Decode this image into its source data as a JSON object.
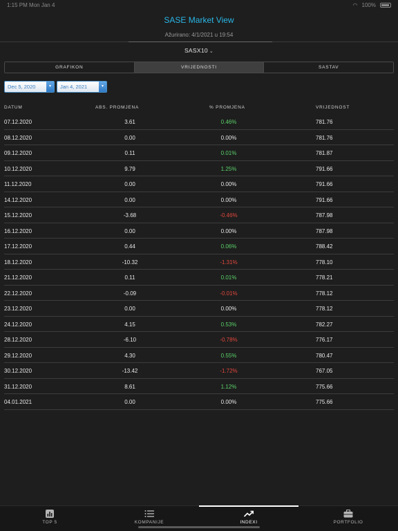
{
  "status": {
    "time": "1:15 PM",
    "date": "Mon Jan 4",
    "battery": "100%"
  },
  "header": {
    "title": "SASE Market View",
    "updated": "Ažurirano: 4/1/2021 u 19:54",
    "index_name": "SASX10"
  },
  "tabs": {
    "grafikon": "GRAFIKON",
    "vrijednosti": "VRIJEDNOSTI",
    "sastav": "SASTAV"
  },
  "dates": {
    "from": "Dec 5, 2020",
    "to": "Jan 4, 2021"
  },
  "table": {
    "headers": {
      "datum": "DATUM",
      "abs": "ABS. PROMJENA",
      "pct": "% PROMJENA",
      "value": "VRIJEDNOST"
    },
    "rows": [
      {
        "date": "07.12.2020",
        "abs": "3.61",
        "pct": "0.46%",
        "value": "781.76",
        "dir": "pos"
      },
      {
        "date": "08.12.2020",
        "abs": "0.00",
        "pct": "0.00%",
        "value": "781.76",
        "dir": "zero"
      },
      {
        "date": "09.12.2020",
        "abs": "0.11",
        "pct": "0.01%",
        "value": "781.87",
        "dir": "pos"
      },
      {
        "date": "10.12.2020",
        "abs": "9.79",
        "pct": "1.25%",
        "value": "791.66",
        "dir": "pos"
      },
      {
        "date": "11.12.2020",
        "abs": "0.00",
        "pct": "0.00%",
        "value": "791.66",
        "dir": "zero"
      },
      {
        "date": "14.12.2020",
        "abs": "0.00",
        "pct": "0.00%",
        "value": "791.66",
        "dir": "zero"
      },
      {
        "date": "15.12.2020",
        "abs": "-3.68",
        "pct": "-0.46%",
        "value": "787.98",
        "dir": "neg"
      },
      {
        "date": "16.12.2020",
        "abs": "0.00",
        "pct": "0.00%",
        "value": "787.98",
        "dir": "zero"
      },
      {
        "date": "17.12.2020",
        "abs": "0.44",
        "pct": "0.06%",
        "value": "788.42",
        "dir": "pos"
      },
      {
        "date": "18.12.2020",
        "abs": "-10.32",
        "pct": "-1.31%",
        "value": "778.10",
        "dir": "neg"
      },
      {
        "date": "21.12.2020",
        "abs": "0.11",
        "pct": "0.01%",
        "value": "778.21",
        "dir": "pos"
      },
      {
        "date": "22.12.2020",
        "abs": "-0.09",
        "pct": "-0.01%",
        "value": "778.12",
        "dir": "neg"
      },
      {
        "date": "23.12.2020",
        "abs": "0.00",
        "pct": "0.00%",
        "value": "778.12",
        "dir": "zero"
      },
      {
        "date": "24.12.2020",
        "abs": "4.15",
        "pct": "0.53%",
        "value": "782.27",
        "dir": "pos"
      },
      {
        "date": "28.12.2020",
        "abs": "-6.10",
        "pct": "-0.78%",
        "value": "776.17",
        "dir": "neg"
      },
      {
        "date": "29.12.2020",
        "abs": "4.30",
        "pct": "0.55%",
        "value": "780.47",
        "dir": "pos"
      },
      {
        "date": "30.12.2020",
        "abs": "-13.42",
        "pct": "-1.72%",
        "value": "767.05",
        "dir": "neg"
      },
      {
        "date": "31.12.2020",
        "abs": "8.61",
        "pct": "1.12%",
        "value": "775.66",
        "dir": "pos"
      },
      {
        "date": "04.01.2021",
        "abs": "0.00",
        "pct": "0.00%",
        "value": "775.66",
        "dir": "zero"
      }
    ]
  },
  "tabbar": {
    "top5": "TOP 5",
    "kompanije": "KOMPANIJE",
    "indexi": "INDEXI",
    "portfolio": "PORTFOLIO"
  },
  "colors": {
    "accent": "#29b6e6",
    "positive": "#5bd16a",
    "negative": "#e0483c"
  }
}
